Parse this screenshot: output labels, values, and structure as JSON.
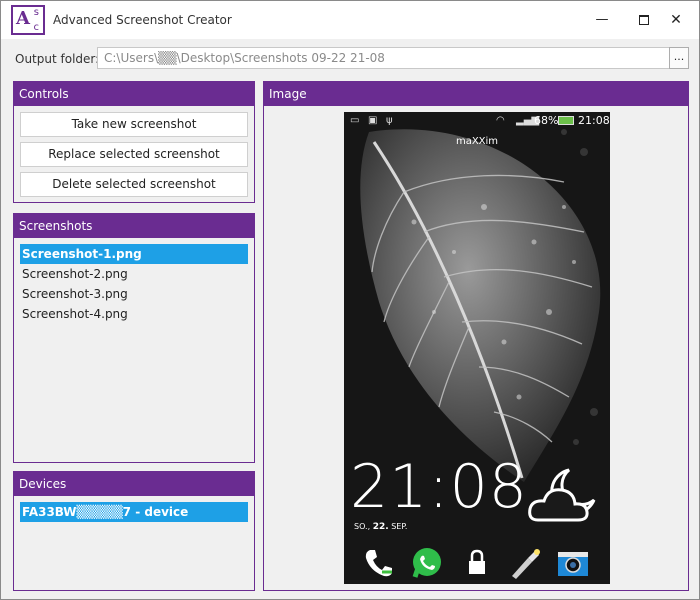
{
  "window": {
    "title": "Advanced Screenshot Creator",
    "logo_letters": [
      "A",
      "s",
      "c"
    ],
    "minimize_glyph": "—",
    "close_glyph": "✕"
  },
  "output": {
    "label": "Output folder:",
    "path": "C:\\Users\\▒▒\\Desktop\\Screenshots 09-22 21-08",
    "browse_label": "..."
  },
  "controls": {
    "title": "Controls",
    "take_label": "Take new screenshot",
    "replace_label": "Replace selected screenshot",
    "delete_label": "Delete selected screenshot"
  },
  "screenshots": {
    "title": "Screenshots",
    "items": [
      "Screenshot-1.png",
      "Screenshot-2.png",
      "Screenshot-3.png",
      "Screenshot-4.png"
    ],
    "selected_index": 0
  },
  "devices": {
    "title": "Devices",
    "items": [
      "FA33BW▒▒▒▒▒7 - device"
    ]
  },
  "image_panel": {
    "title": "Image",
    "phone": {
      "battery_pct": "68%",
      "status_time": "21:08",
      "carrier": "maXXim",
      "clock": "21:08",
      "date_day": "SO.,",
      "date_num": "22.",
      "date_month": "SEP.",
      "status_icons": [
        "notification-icon",
        "screenshot-icon",
        "usb-icon",
        "wifi-icon",
        "signal-icon",
        "battery-icon"
      ],
      "dock_icons": [
        "phone-icon",
        "whatsapp-icon",
        "lock-icon",
        "flashlight-icon",
        "camera-icon"
      ]
    }
  },
  "colors": {
    "accent": "#6a2c91",
    "selection": "#1ea0e6"
  }
}
